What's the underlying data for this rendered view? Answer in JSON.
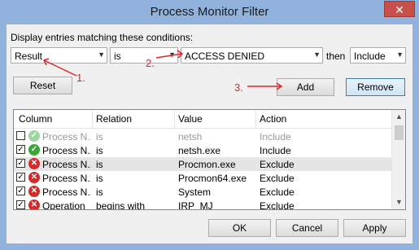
{
  "window": {
    "title": "Process Monitor Filter",
    "close_glyph": "✕"
  },
  "conditions_label": "Display entries matching these conditions:",
  "filter": {
    "column": "Result",
    "relation": "is",
    "value": "ACCESS DENIED",
    "then_label": "then",
    "action": "Include"
  },
  "buttons": {
    "reset": "Reset",
    "add": "Add",
    "remove": "Remove",
    "ok": "OK",
    "cancel": "Cancel",
    "apply": "Apply"
  },
  "annotations": {
    "step1": "1.",
    "step2": "2.",
    "step3": "3."
  },
  "columns": [
    "Column",
    "Relation",
    "Value",
    "Action"
  ],
  "rows": [
    {
      "checked": false,
      "icon": "check-icon",
      "column": "Process N...",
      "relation": "is",
      "value": "netsh",
      "action": "Include"
    },
    {
      "checked": true,
      "icon": "check-icon",
      "column": "Process N...",
      "relation": "is",
      "value": "netsh.exe",
      "action": "Include"
    },
    {
      "checked": true,
      "icon": "exclude-icon",
      "column": "Process N...",
      "relation": "is",
      "value": "Procmon.exe",
      "action": "Exclude"
    },
    {
      "checked": true,
      "icon": "exclude-icon",
      "column": "Process N...",
      "relation": "is",
      "value": "Procmon64.exe",
      "action": "Exclude"
    },
    {
      "checked": true,
      "icon": "exclude-icon",
      "column": "Process N...",
      "relation": "is",
      "value": "System",
      "action": "Exclude"
    },
    {
      "checked": true,
      "icon": "exclude-icon",
      "column": "Operation",
      "relation": "begins with",
      "value": "IRP_MJ_",
      "action": "Exclude"
    }
  ],
  "colors": {
    "title_bg": "#92b2de",
    "close": "#c7504b",
    "annotation": "#e0262b",
    "include_icon": "#3aa63a",
    "exclude_icon": "#d12b2b"
  }
}
